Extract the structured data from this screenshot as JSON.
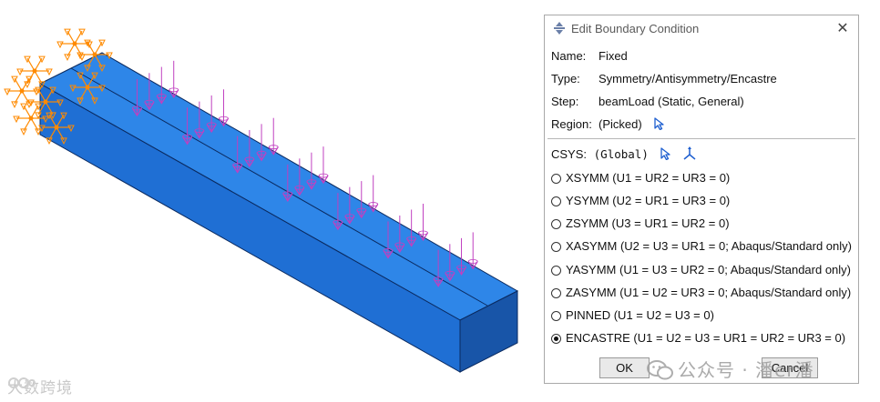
{
  "dialog": {
    "title": "Edit Boundary Condition",
    "close_glyph": "✕",
    "name": {
      "label": "Name:",
      "value": "Fixed"
    },
    "type": {
      "label": "Type:",
      "value": "Symmetry/Antisymmetry/Encastre"
    },
    "step": {
      "label": "Step:",
      "value": "beamLoad (Static, General)"
    },
    "region": {
      "label": "Region:",
      "value": "(Picked)"
    },
    "csys": {
      "label": "CSYS:",
      "value": "(Global)"
    },
    "options": [
      {
        "label": "XSYMM (U1 = UR2 = UR3 = 0)",
        "selected": false
      },
      {
        "label": "YSYMM (U2 = UR1 = UR3 = 0)",
        "selected": false
      },
      {
        "label": "ZSYMM (U3 = UR1 = UR2 = 0)",
        "selected": false
      },
      {
        "label": "XASYMM (U2 = U3 = UR1 = 0; Abaqus/Standard only)",
        "selected": false
      },
      {
        "label": "YASYMM (U1 = U3 = UR2 = 0; Abaqus/Standard only)",
        "selected": false
      },
      {
        "label": "ZASYMM (U1 = U2 = UR3 = 0; Abaqus/Standard only)",
        "selected": false
      },
      {
        "label": "PINNED (U1 = U2 = U3 = 0)",
        "selected": false
      },
      {
        "label": "ENCASTRE (U1 = U2 = U3 = UR1 = UR2 = UR3 = 0)",
        "selected": true
      }
    ],
    "ok_label": "OK",
    "cancel_label": "Cancel"
  },
  "watermarks": {
    "left": "大数跨境",
    "right": "公众号 · 潘er潘"
  },
  "colors": {
    "beam_top": "#2e86e8",
    "beam_side": "#1f6fd4",
    "beam_end": "#1855a8",
    "bc_symbol": "#ff8a00",
    "load_arrow": "#c040c0"
  },
  "icons": [
    "abaqus-app-icon",
    "close-icon",
    "pick-arrow-icon",
    "csys-triad-icon",
    "wechat-icon"
  ]
}
